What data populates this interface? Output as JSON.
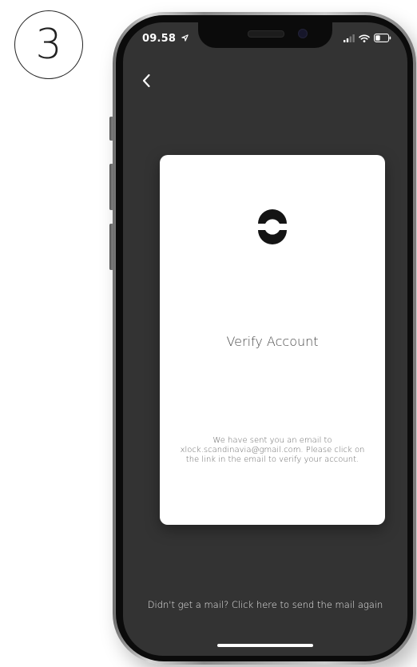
{
  "step": {
    "number": "3"
  },
  "status_bar": {
    "time": "09.58"
  },
  "card": {
    "title": "Verify Account",
    "message_line1": "We have sent you an email to",
    "message_line2": "xlock.scandinavia@gmail.com. Please click on",
    "message_line3": "the link in the email to verify your account."
  },
  "footer": {
    "resend_text": "Didn't get a mail? Click here to send the mail again"
  },
  "icons": {
    "back": "chevron-left-icon",
    "location": "location-arrow-icon",
    "signal": "signal-bars-icon",
    "wifi": "wifi-icon",
    "battery": "battery-icon",
    "logo": "brand-logo-icon"
  },
  "colors": {
    "screen_background": "#333333",
    "card_background": "#ffffff",
    "text_light": "#e8e8e8"
  }
}
